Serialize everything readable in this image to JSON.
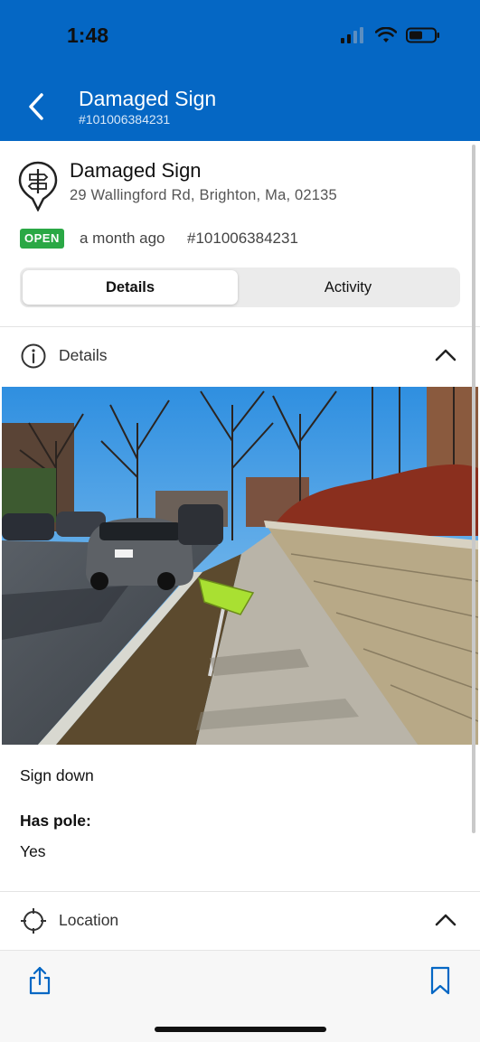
{
  "status_bar": {
    "time": "1:48"
  },
  "header": {
    "title": "Damaged Sign",
    "subtitle": "#101006384231"
  },
  "request": {
    "title": "Damaged Sign",
    "address": "29 Wallingford Rd, Brighton, Ma, 02135",
    "status": "OPEN",
    "time_ago": "a month ago",
    "id": "#101006384231"
  },
  "tabs": [
    {
      "label": "Details",
      "active": true
    },
    {
      "label": "Activity",
      "active": false
    }
  ],
  "details_section": {
    "label": "Details",
    "description": "Sign down",
    "has_pole_label": "Has pole:",
    "has_pole_value": "Yes"
  },
  "location_section": {
    "label": "Location"
  },
  "colors": {
    "header": "#0567c4",
    "open_badge": "#2aa845"
  }
}
